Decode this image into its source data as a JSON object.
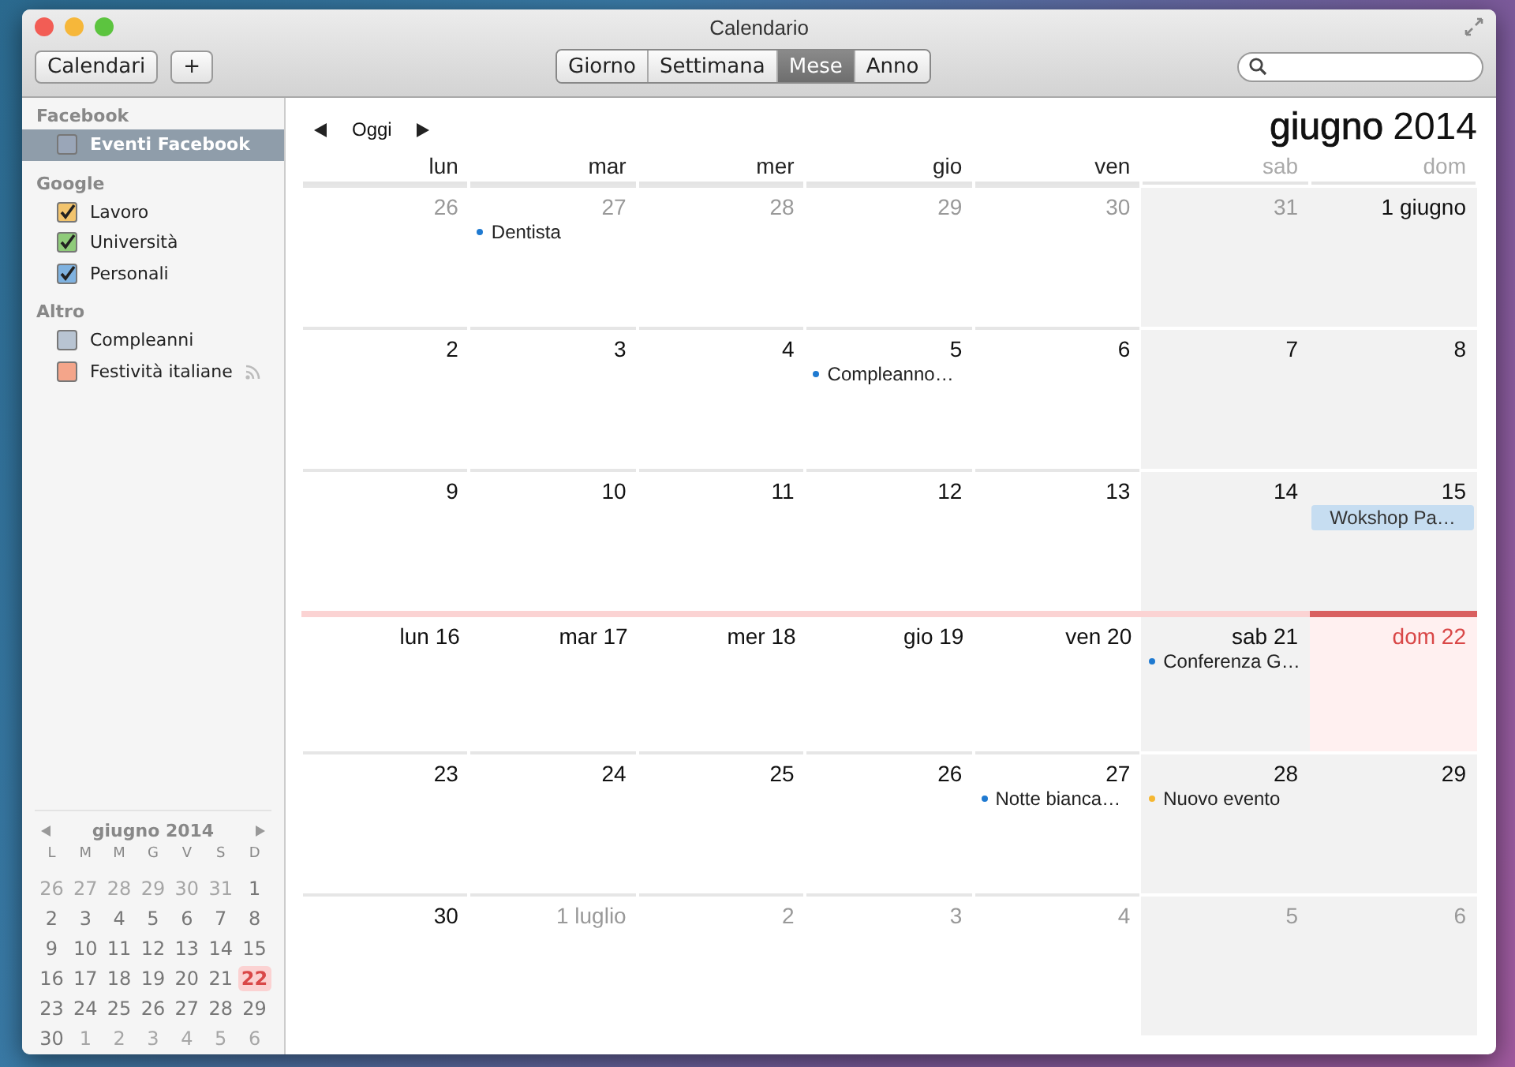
{
  "window": {
    "title": "Calendario"
  },
  "toolbar": {
    "buttons": [
      "Calendari",
      "+"
    ],
    "views": [
      {
        "label": "Giorno",
        "selected": false
      },
      {
        "label": "Settimana",
        "selected": false
      },
      {
        "label": "Mese",
        "selected": true
      },
      {
        "label": "Anno",
        "selected": false
      }
    ]
  },
  "sidebar": {
    "groups": [
      {
        "name": "Facebook",
        "items": [
          {
            "label": "Eventi Facebook",
            "checked": false,
            "selected": true,
            "subscribed": false,
            "color": "#9aa6b8"
          }
        ]
      },
      {
        "name": "Google",
        "items": [
          {
            "label": "Lavoro",
            "checked": true,
            "selected": false,
            "subscribed": false,
            "color": "#f2c46d"
          },
          {
            "label": "Università",
            "checked": true,
            "selected": false,
            "subscribed": false,
            "color": "#8fcb7a"
          },
          {
            "label": "Personali",
            "checked": true,
            "selected": false,
            "subscribed": false,
            "color": "#7fb2e0"
          }
        ]
      },
      {
        "name": "Altro",
        "items": [
          {
            "label": "Compleanni",
            "checked": false,
            "selected": false,
            "subscribed": false,
            "color": "#b8c4d2"
          },
          {
            "label": "Festività italiane",
            "checked": false,
            "selected": false,
            "subscribed": true,
            "color": "#f4a58a"
          }
        ]
      }
    ]
  },
  "nav": {
    "today": "Oggi",
    "month": "giugno",
    "year": "2014"
  },
  "weekdays": [
    {
      "label": "lun",
      "weekend": false
    },
    {
      "label": "mar",
      "weekend": false
    },
    {
      "label": "mer",
      "weekend": false
    },
    {
      "label": "gio",
      "weekend": false
    },
    {
      "label": "ven",
      "weekend": false
    },
    {
      "label": "sab",
      "weekend": true
    },
    {
      "label": "dom",
      "weekend": true
    }
  ],
  "weeks": [
    {
      "current": false,
      "days": [
        {
          "label": "26",
          "other_month": true,
          "today": false
        },
        {
          "label": "27",
          "other_month": true,
          "today": false,
          "events": [
            {
              "kind": "dot",
              "title": "Dentista",
              "color": "#1f7ad1"
            }
          ]
        },
        {
          "label": "28",
          "other_month": true,
          "today": false
        },
        {
          "label": "29",
          "other_month": true,
          "today": false
        },
        {
          "label": "30",
          "other_month": true,
          "today": false
        },
        {
          "label": "31",
          "other_month": true,
          "today": false
        },
        {
          "label": "1 giugno",
          "other_month": false,
          "today": false
        }
      ]
    },
    {
      "current": false,
      "days": [
        {
          "label": "2",
          "other_month": false,
          "today": false
        },
        {
          "label": "3",
          "other_month": false,
          "today": false
        },
        {
          "label": "4",
          "other_month": false,
          "today": false
        },
        {
          "label": "5",
          "other_month": false,
          "today": false,
          "events": [
            {
              "kind": "dot",
              "title": "Compleanno…",
              "color": "#1f7ad1"
            }
          ]
        },
        {
          "label": "6",
          "other_month": false,
          "today": false
        },
        {
          "label": "7",
          "other_month": false,
          "today": false
        },
        {
          "label": "8",
          "other_month": false,
          "today": false
        }
      ]
    },
    {
      "current": false,
      "days": [
        {
          "label": "9",
          "other_month": false,
          "today": false
        },
        {
          "label": "10",
          "other_month": false,
          "today": false
        },
        {
          "label": "11",
          "other_month": false,
          "today": false
        },
        {
          "label": "12",
          "other_month": false,
          "today": false
        },
        {
          "label": "13",
          "other_month": false,
          "today": false
        },
        {
          "label": "14",
          "other_month": false,
          "today": false
        },
        {
          "label": "15",
          "other_month": false,
          "today": false,
          "events": [
            {
              "kind": "bar",
              "title": "Wokshop Pa…",
              "color": "#c6ddf1"
            }
          ]
        }
      ]
    },
    {
      "current": true,
      "days": [
        {
          "label": "lun 16",
          "other_month": false,
          "today": false
        },
        {
          "label": "mar 17",
          "other_month": false,
          "today": false
        },
        {
          "label": "mer 18",
          "other_month": false,
          "today": false
        },
        {
          "label": "gio 19",
          "other_month": false,
          "today": false
        },
        {
          "label": "ven 20",
          "other_month": false,
          "today": false
        },
        {
          "label": "sab 21",
          "other_month": false,
          "today": false,
          "events": [
            {
              "kind": "dot",
              "title": "Conferenza G…",
              "color": "#1f7ad1"
            }
          ]
        },
        {
          "label": "dom 22",
          "other_month": false,
          "today": true
        }
      ]
    },
    {
      "current": false,
      "days": [
        {
          "label": "23",
          "other_month": false,
          "today": false
        },
        {
          "label": "24",
          "other_month": false,
          "today": false
        },
        {
          "label": "25",
          "other_month": false,
          "today": false
        },
        {
          "label": "26",
          "other_month": false,
          "today": false
        },
        {
          "label": "27",
          "other_month": false,
          "today": false,
          "events": [
            {
              "kind": "dot",
              "title": "Notte bianca…",
              "color": "#1f7ad1"
            }
          ]
        },
        {
          "label": "28",
          "other_month": false,
          "today": false,
          "events": [
            {
              "kind": "dot",
              "title": "Nuovo evento",
              "color": "#f5b731"
            }
          ]
        },
        {
          "label": "29",
          "other_month": false,
          "today": false
        }
      ]
    },
    {
      "current": false,
      "days": [
        {
          "label": "30",
          "other_month": false,
          "today": false
        },
        {
          "label": "1 luglio",
          "other_month": true,
          "today": false
        },
        {
          "label": "2",
          "other_month": true,
          "today": false
        },
        {
          "label": "3",
          "other_month": true,
          "today": false
        },
        {
          "label": "4",
          "other_month": true,
          "today": false
        },
        {
          "label": "5",
          "other_month": true,
          "today": false
        },
        {
          "label": "6",
          "other_month": true,
          "today": false
        }
      ]
    }
  ],
  "mini_calendar": {
    "title": "giugno 2014",
    "weekdays": [
      "L",
      "M",
      "M",
      "G",
      "V",
      "S",
      "D"
    ],
    "weeks": [
      [
        {
          "label": "26",
          "other_month": true,
          "today": false
        },
        {
          "label": "27",
          "other_month": true,
          "today": false
        },
        {
          "label": "28",
          "other_month": true,
          "today": false
        },
        {
          "label": "29",
          "other_month": true,
          "today": false
        },
        {
          "label": "30",
          "other_month": true,
          "today": false
        },
        {
          "label": "31",
          "other_month": true,
          "today": false
        },
        {
          "label": "1",
          "other_month": false,
          "today": false
        }
      ],
      [
        {
          "label": "2",
          "other_month": false,
          "today": false
        },
        {
          "label": "3",
          "other_month": false,
          "today": false
        },
        {
          "label": "4",
          "other_month": false,
          "today": false
        },
        {
          "label": "5",
          "other_month": false,
          "today": false
        },
        {
          "label": "6",
          "other_month": false,
          "today": false
        },
        {
          "label": "7",
          "other_month": false,
          "today": false
        },
        {
          "label": "8",
          "other_month": false,
          "today": false
        }
      ],
      [
        {
          "label": "9",
          "other_month": false,
          "today": false
        },
        {
          "label": "10",
          "other_month": false,
          "today": false
        },
        {
          "label": "11",
          "other_month": false,
          "today": false
        },
        {
          "label": "12",
          "other_month": false,
          "today": false
        },
        {
          "label": "13",
          "other_month": false,
          "today": false
        },
        {
          "label": "14",
          "other_month": false,
          "today": false
        },
        {
          "label": "15",
          "other_month": false,
          "today": false
        }
      ],
      [
        {
          "label": "16",
          "other_month": false,
          "today": false
        },
        {
          "label": "17",
          "other_month": false,
          "today": false
        },
        {
          "label": "18",
          "other_month": false,
          "today": false
        },
        {
          "label": "19",
          "other_month": false,
          "today": false
        },
        {
          "label": "20",
          "other_month": false,
          "today": false
        },
        {
          "label": "21",
          "other_month": false,
          "today": false
        },
        {
          "label": "22",
          "other_month": false,
          "today": true
        }
      ],
      [
        {
          "label": "23",
          "other_month": false,
          "today": false
        },
        {
          "label": "24",
          "other_month": false,
          "today": false
        },
        {
          "label": "25",
          "other_month": false,
          "today": false
        },
        {
          "label": "26",
          "other_month": false,
          "today": false
        },
        {
          "label": "27",
          "other_month": false,
          "today": false
        },
        {
          "label": "28",
          "other_month": false,
          "today": false
        },
        {
          "label": "29",
          "other_month": false,
          "today": false
        }
      ],
      [
        {
          "label": "30",
          "other_month": false,
          "today": false
        },
        {
          "label": "1",
          "other_month": true,
          "today": false
        },
        {
          "label": "2",
          "other_month": true,
          "today": false
        },
        {
          "label": "3",
          "other_month": true,
          "today": false
        },
        {
          "label": "4",
          "other_month": true,
          "today": false
        },
        {
          "label": "5",
          "other_month": true,
          "today": false
        },
        {
          "label": "6",
          "other_month": true,
          "today": false
        }
      ]
    ]
  }
}
